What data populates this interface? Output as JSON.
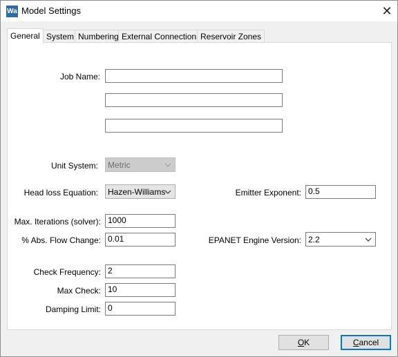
{
  "window": {
    "title": "Model Settings",
    "app_icon_text": "Wa",
    "close_glyph": "✕"
  },
  "tabs": [
    {
      "label": "General"
    },
    {
      "label": "System"
    },
    {
      "label": "Numbering"
    },
    {
      "label": "External Connections"
    },
    {
      "label": "Reservoir Zones"
    }
  ],
  "form": {
    "job_name_label": "Job Name:",
    "job_name_lines": [
      "",
      "",
      ""
    ],
    "unit_system_label": "Unit System:",
    "unit_system_value": "Metric",
    "headloss_label": "Head loss Equation:",
    "headloss_value": "Hazen-Williams",
    "emitter_label": "Emitter Exponent:",
    "emitter_value": "0.5",
    "max_iter_label": "Max. Iterations (solver):",
    "max_iter_value": "1000",
    "flow_change_label": "% Abs. Flow Change:",
    "flow_change_value": "0.01",
    "epanet_label": "EPANET Engine Version:",
    "epanet_value": "2.2",
    "check_freq_label": "Check Frequency:",
    "check_freq_value": "2",
    "max_check_label": "Max Check:",
    "max_check_value": "10",
    "damping_label": "Damping Limit:",
    "damping_value": "0"
  },
  "buttons": {
    "ok_first": "O",
    "ok_rest": "K",
    "cancel_first": "C",
    "cancel_rest": "ancel"
  },
  "icons": {
    "close": "close-icon",
    "dropdown": "chevron-down-icon",
    "app": "app-icon"
  }
}
